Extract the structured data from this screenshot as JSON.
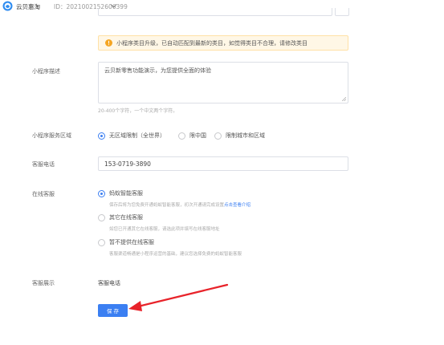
{
  "header": {
    "app_name": "云贝惠淘",
    "id_text": "ID：2021002152606399"
  },
  "notice": {
    "text": "小程序类目升级，已自动匹配到最新的类目，如觉得类目不合理，请修改类目"
  },
  "description": {
    "label": "小程序描述",
    "value": "云贝新零售功能演示，为您提供全面的体验",
    "hint": "20-400个字符，一个中文两个字符。"
  },
  "service_area": {
    "label": "小程序服务区域",
    "options": [
      {
        "label": "无区域限制（全世界）",
        "checked": true
      },
      {
        "label": "限中国",
        "checked": false
      },
      {
        "label": "限制城市和区域",
        "checked": false
      }
    ]
  },
  "phone": {
    "label": "客服电话",
    "value": "153-0719-3890"
  },
  "online_service": {
    "label": "在线客服",
    "options": [
      {
        "label": "蚂蚁智能客服",
        "desc": "保存后将为您免费开通蚂蚁智能客服，初次开通请完成设置",
        "link": "点击查看介绍",
        "checked": true
      },
      {
        "label": "其它在线客服",
        "desc": "如您已开通其它在线客服，请选此项并填写在线客服地址",
        "checked": false
      },
      {
        "label": "暂不提供在线客服",
        "desc": "客服渠道畅通是小程序运营的基础，建议您选择免费的蚂蚁智能客服",
        "checked": false
      }
    ]
  },
  "display": {
    "label": "客服展示",
    "value": "客服电话"
  },
  "save_label": "保 存",
  "colors": {
    "accent": "#3b7ff2",
    "warning": "#f5a623",
    "annotation_arrow": "#e8232a"
  }
}
